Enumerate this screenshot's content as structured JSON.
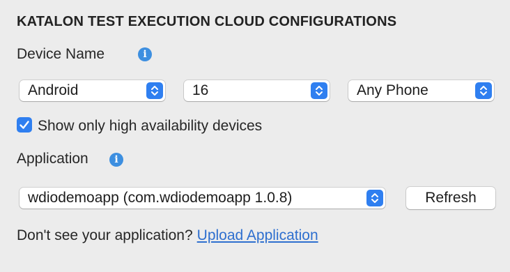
{
  "section": {
    "title": "KATALON TEST EXECUTION CLOUD CONFIGURATIONS"
  },
  "device": {
    "label": "Device Name",
    "os_value": "Android",
    "version_value": "16",
    "model_value": "Any Phone",
    "high_availability_label": "Show only high availability devices",
    "high_availability_checked": true
  },
  "application": {
    "label": "Application",
    "selected_value": "wdiodemoapp (com.wdiodemoapp 1.0.8)",
    "refresh_label": "Refresh"
  },
  "footer": {
    "prompt": "Don't see your application?",
    "upload_link": "Upload Application"
  },
  "icons": {
    "info": "info-icon",
    "stepper": "chevron-up-down-icon",
    "check": "checkmark-icon"
  },
  "colors": {
    "accent": "#2f7ff0",
    "info": "#3d8fe0",
    "link": "#2e6fcf",
    "background": "#ececec"
  }
}
